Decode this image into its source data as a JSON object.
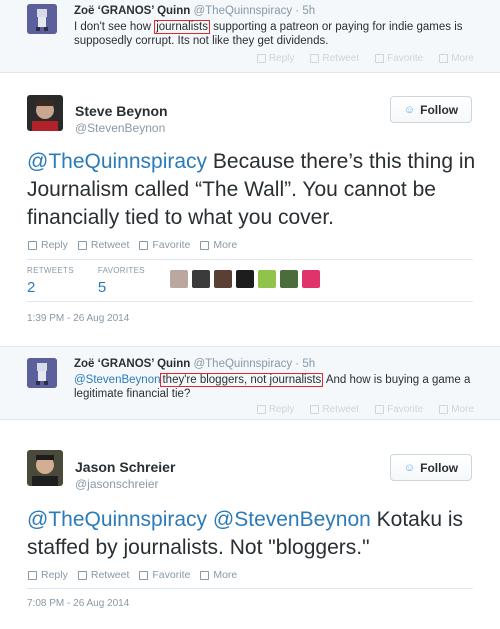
{
  "actions": {
    "reply": "Reply",
    "retweet": "Retweet",
    "favorite": "Favorite",
    "more": "More"
  },
  "tweet1": {
    "name": "Zoë ‘GRANOS’ Quinn",
    "handle": "@TheQuinnspiracy",
    "time": "· 5h",
    "text_before": "I don't see how ",
    "text_highlight": "journalists",
    "text_after": " supporting a patreon or paying for indie games is supposedly corrupt. Its not like they get dividends."
  },
  "tweet2": {
    "name": "Steve Beynon",
    "handle": "@StevenBeynon",
    "follow_label": "Follow",
    "mention": "@TheQuinnspiracy",
    "text": " Because there’s this thing in Journalism called “The Wall”. You cannot be financially tied to what you cover.",
    "retweets_label": "RETWEETS",
    "retweets_count": "2",
    "favorites_label": "FAVORITES",
    "favorites_count": "5",
    "timestamp": "1:39 PM - 26 Aug 2014",
    "face_colors": [
      "#b9a7a0",
      "#3b3b3b",
      "#5a3f34",
      "#1d1d1d",
      "#8fc34a",
      "#4a6d3a",
      "#e0336b"
    ]
  },
  "tweet3": {
    "name": "Zoë ‘GRANOS’ Quinn",
    "handle": "@TheQuinnspiracy",
    "time": "· 5h",
    "mention": "@StevenBeynon",
    "text_highlight": "they're bloggers, not journalists",
    "text_after": " And how is buying a game a legitimate financial tie?"
  },
  "tweet4": {
    "name": "Jason Schreier",
    "handle": "@jasonschreier",
    "follow_label": "Follow",
    "mention1": "@TheQuinnspiracy",
    "mention2": "@StevenBeynon",
    "text": " Kotaku is staffed by journalists. Not \"bloggers.\"",
    "timestamp": "7:08 PM - 26 Aug 2014"
  }
}
